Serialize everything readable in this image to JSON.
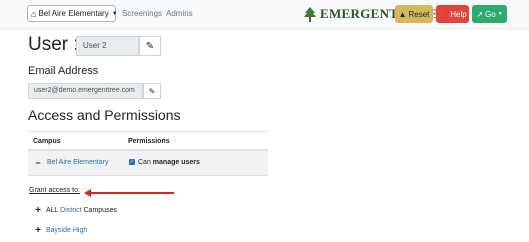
{
  "navbar": {
    "school_label": "Bel Aire Elementary",
    "links": [
      "Screenings",
      "Admins"
    ],
    "logo_text": "EMERGENT TREE",
    "buttons": {
      "reset": "Reset",
      "help": "Help",
      "go": "Go"
    }
  },
  "user": {
    "label": "User :",
    "value": "User 2"
  },
  "email": {
    "heading": "Email Address",
    "value": "user2@demo.emergenttree.com"
  },
  "access": {
    "heading": "Access and Permissions",
    "columns": [
      "Campus",
      "Permissions"
    ],
    "rows": [
      {
        "campus": "Bel Aire Elementary",
        "perm_prefix": "Can",
        "perm_bold": "manage users"
      }
    ]
  },
  "grant": {
    "label": "Grant access to:",
    "all_prefix": "ALL",
    "all_link": "District",
    "all_suffix": "Campuses",
    "campus": "Bayside High"
  },
  "colors": {
    "reset": "#d4b85c",
    "help": "#e0443c",
    "go": "#2eaa6f",
    "link": "#2a6fb0",
    "annotation_arrow": "#d8261c",
    "logo": "#2f4f2a"
  }
}
